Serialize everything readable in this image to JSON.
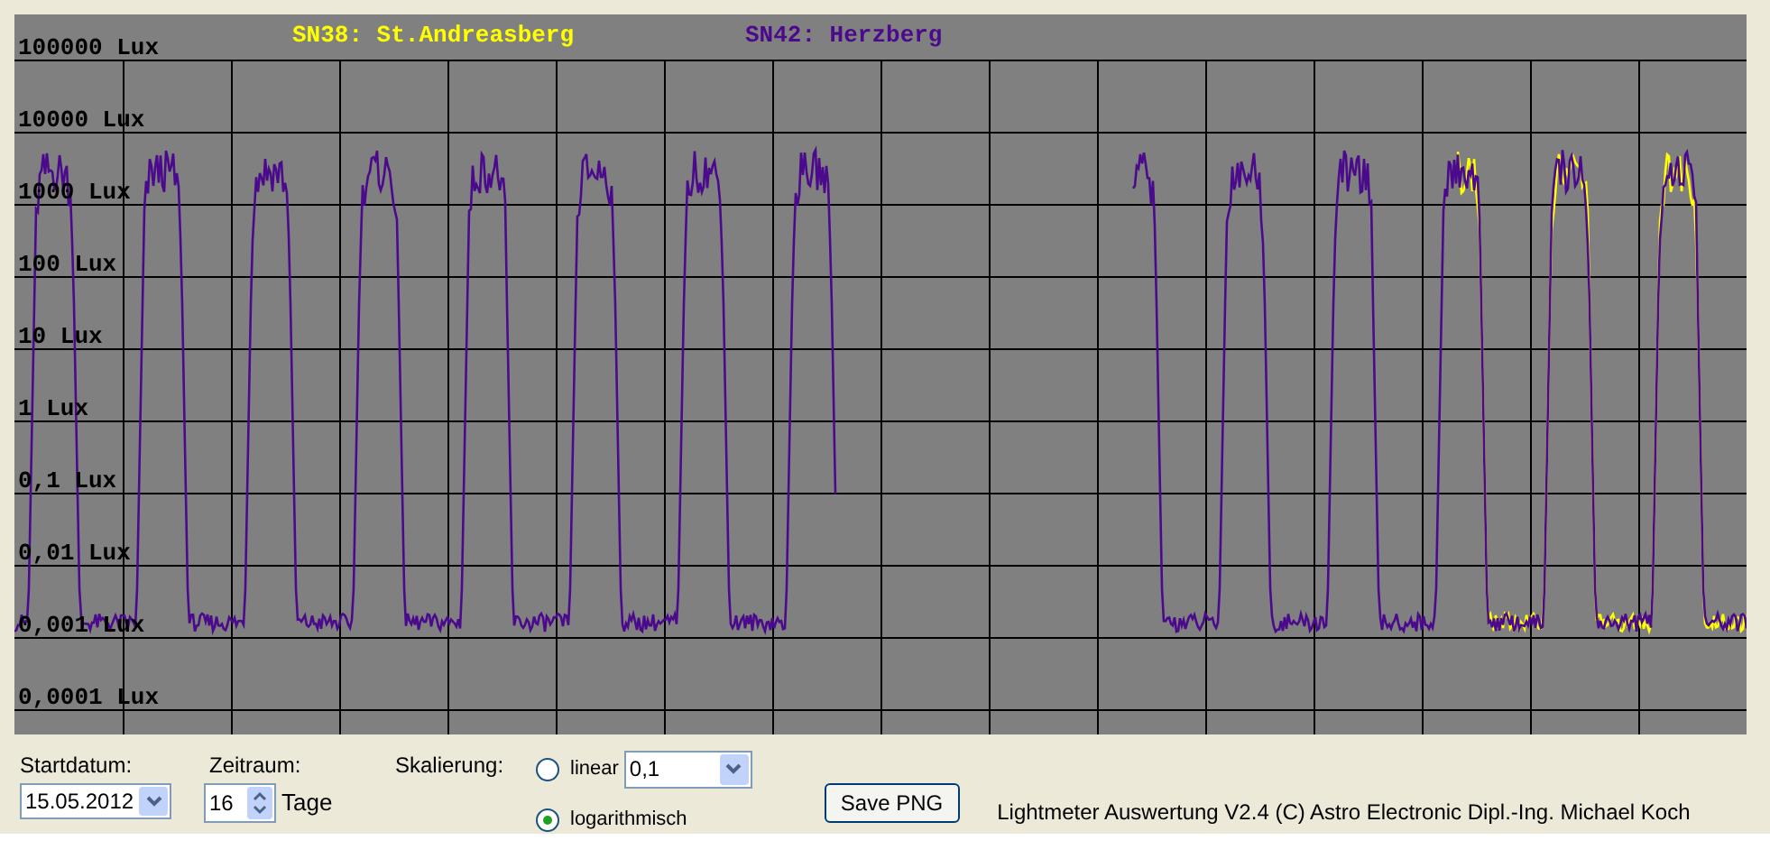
{
  "chart": {
    "legend": [
      {
        "label": "SN38: St.Andreasberg",
        "color": "#ffff00"
      },
      {
        "label": "SN42: Herzberg",
        "color": "#4b0a8c"
      }
    ],
    "y_axis_labels": [
      "100000 Lux",
      "10000 Lux",
      "1000 Lux",
      "100 Lux",
      "10 Lux",
      "1 Lux",
      "0,1 Lux",
      "0,01 Lux",
      "0,001 Lux",
      "0,0001 Lux"
    ]
  },
  "controls": {
    "start_date": {
      "label": "Startdatum:",
      "value": "15.05.2012"
    },
    "period": {
      "label": "Zeitraum:",
      "value": "16",
      "unit": "Tage"
    },
    "scaling": {
      "label": "Skalierung:",
      "options": [
        {
          "label": "linear",
          "selected": false
        },
        {
          "label": "logarithmisch",
          "selected": true
        }
      ],
      "factor": "0,1"
    },
    "save_button": "Save PNG"
  },
  "footer": "Lightmeter Auswertung V2.4  (C) Astro Electronic Dipl.-Ing. Michael Koch"
}
